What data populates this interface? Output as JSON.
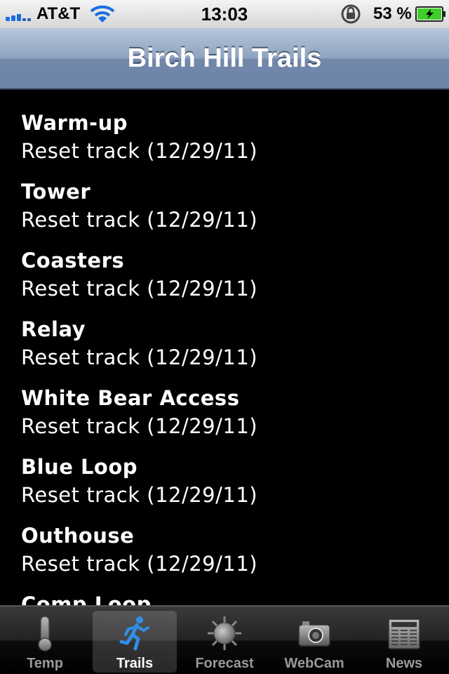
{
  "status_bar": {
    "carrier": "AT&T",
    "time": "13:03",
    "battery_percent": "53 %"
  },
  "nav": {
    "title": "Birch Hill Trails"
  },
  "trails": [
    {
      "name": "Warm-up",
      "status": "Reset track (12/29/11)"
    },
    {
      "name": "Tower",
      "status": "Reset track (12/29/11)"
    },
    {
      "name": "Coasters",
      "status": "Reset track (12/29/11)"
    },
    {
      "name": "Relay",
      "status": "Reset track (12/29/11)"
    },
    {
      "name": "White Bear Access",
      "status": "Reset track (12/29/11)"
    },
    {
      "name": "Blue Loop",
      "status": "Reset track (12/29/11)"
    },
    {
      "name": "Outhouse",
      "status": "Reset track (12/29/11)"
    },
    {
      "name": "Comp Loop",
      "status": ""
    }
  ],
  "tabs": [
    {
      "label": "Temp",
      "icon": "thermometer-icon"
    },
    {
      "label": "Trails",
      "icon": "skier-icon",
      "selected": true
    },
    {
      "label": "Forecast",
      "icon": "sun-icon"
    },
    {
      "label": "WebCam",
      "icon": "camera-icon"
    },
    {
      "label": "News",
      "icon": "newspaper-icon"
    }
  ],
  "colors": {
    "selected_tab_icon": "#2f8fe8",
    "signal_bars": "#1a6ee0",
    "battery_fill": "#3fcf2a"
  }
}
